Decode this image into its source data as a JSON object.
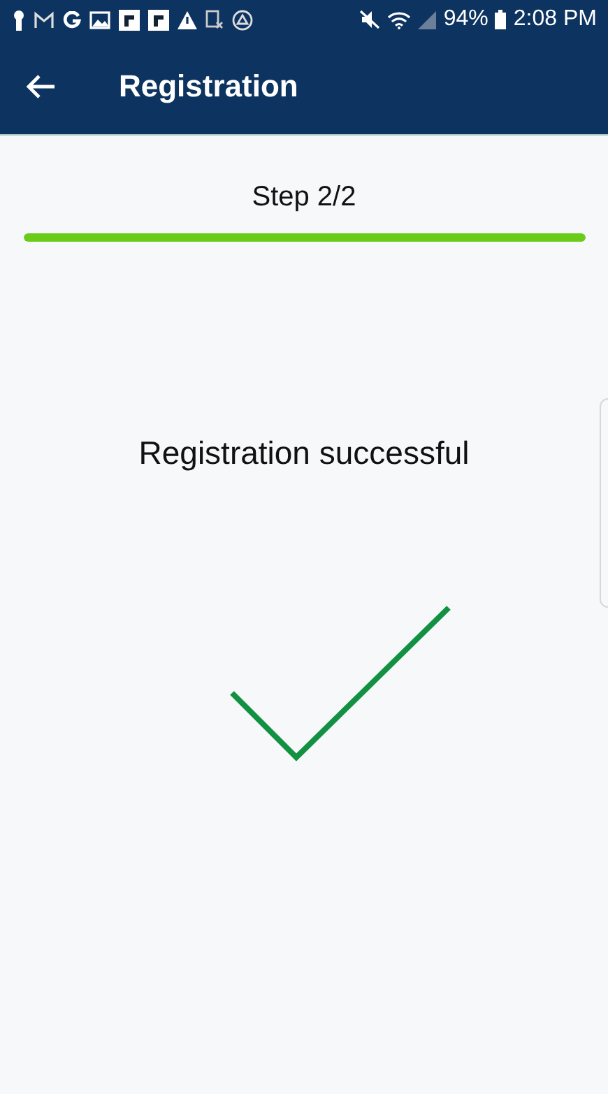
{
  "status_bar": {
    "battery": "94%",
    "time": "2:08 PM"
  },
  "app_bar": {
    "title": "Registration"
  },
  "progress": {
    "label": "Step 2/2",
    "level": 1
  },
  "message": "Registration successful"
}
